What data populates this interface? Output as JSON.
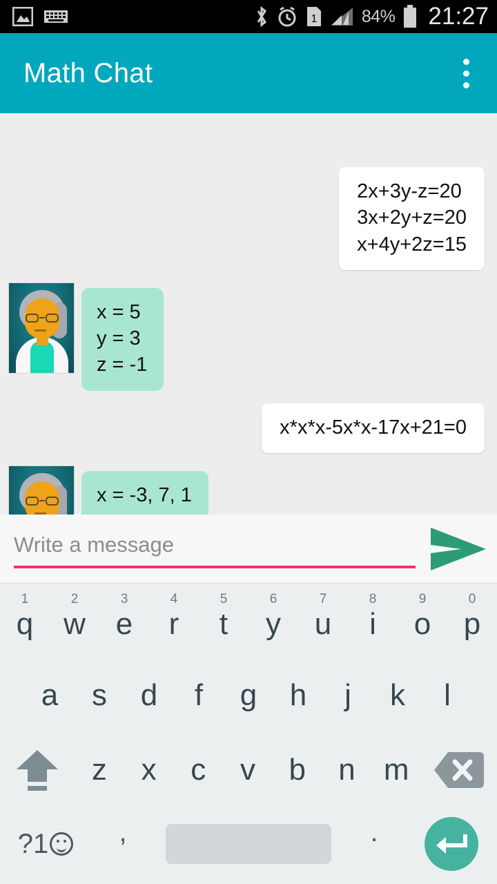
{
  "statusbar": {
    "left_icons": [
      "image-icon",
      "keyboard-icon"
    ],
    "right_icons": [
      "bluetooth-icon",
      "alarm-icon",
      "sim1-icon",
      "signal-icon",
      "battery-icon"
    ],
    "battery_percent": "84%",
    "clock": "21:27"
  },
  "appbar": {
    "title": "Math Chat",
    "overflow_label": "More options",
    "background_color": "#00a7bd"
  },
  "chat": {
    "background_color": "#ededed",
    "messages": [
      {
        "sender": "user",
        "side": "out",
        "lines": [
          "2x+3y-z=20",
          "3x+2y+z=20",
          "x+4y+2z=15"
        ],
        "bubble_color": "#ffffff"
      },
      {
        "sender": "bot",
        "side": "in",
        "lines": [
          "x = 5",
          "y = 3",
          "z = -1"
        ],
        "bubble_color": "#a9e6d2",
        "avatar": "professor-avatar"
      },
      {
        "sender": "user",
        "side": "out",
        "lines": [
          "x*x*x-5x*x-17x+21=0"
        ],
        "bubble_color": "#ffffff"
      },
      {
        "sender": "bot",
        "side": "in",
        "lines": [
          "x = -3, 7, 1"
        ],
        "bubble_color": "#a9e6d2",
        "avatar": "professor-avatar"
      }
    ]
  },
  "input": {
    "placeholder": "Write a message",
    "value": "",
    "underline_color": "#e8366f",
    "send_icon": "send-arrow-icon",
    "send_color": "#2e9b78"
  },
  "keyboard": {
    "row1": [
      {
        "letter": "q",
        "num": "1"
      },
      {
        "letter": "w",
        "num": "2"
      },
      {
        "letter": "e",
        "num": "3"
      },
      {
        "letter": "r",
        "num": "4"
      },
      {
        "letter": "t",
        "num": "5"
      },
      {
        "letter": "y",
        "num": "6"
      },
      {
        "letter": "u",
        "num": "7"
      },
      {
        "letter": "i",
        "num": "8"
      },
      {
        "letter": "o",
        "num": "9"
      },
      {
        "letter": "p",
        "num": "0"
      }
    ],
    "row2": [
      {
        "letter": "a"
      },
      {
        "letter": "s"
      },
      {
        "letter": "d"
      },
      {
        "letter": "f"
      },
      {
        "letter": "g"
      },
      {
        "letter": "h"
      },
      {
        "letter": "j"
      },
      {
        "letter": "k"
      },
      {
        "letter": "l"
      }
    ],
    "row3": [
      {
        "letter": "z"
      },
      {
        "letter": "x"
      },
      {
        "letter": "c"
      },
      {
        "letter": "v"
      },
      {
        "letter": "b"
      },
      {
        "letter": "n"
      },
      {
        "letter": "m"
      }
    ],
    "shift_icon": "shift-icon",
    "backspace_icon": "backspace-icon",
    "symbols_label": "?1",
    "emoji_icon": "emoji-icon",
    "comma_label": ",",
    "period_label": ".",
    "space_label": "",
    "enter_icon": "enter-icon",
    "enter_color": "#46b3a0",
    "background_color": "#eceff0"
  }
}
